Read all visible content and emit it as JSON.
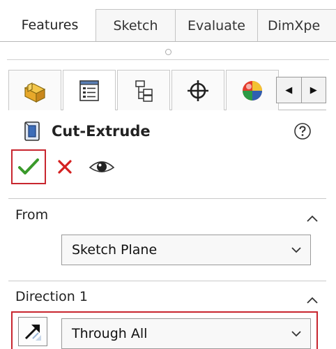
{
  "command_tabs": [
    {
      "label": "Features",
      "active": true
    },
    {
      "label": "Sketch",
      "active": false
    },
    {
      "label": "Evaluate",
      "active": false
    },
    {
      "label": "DimXpe",
      "active": false
    }
  ],
  "manager_tabs": [
    {
      "icon": "featuremanager-design-tree-icon",
      "active": false
    },
    {
      "icon": "propertymanager-icon",
      "active": true
    },
    {
      "icon": "configurationmanager-icon",
      "active": false
    },
    {
      "icon": "dimxpertmanager-icon",
      "active": false
    },
    {
      "icon": "display-manager-icon",
      "active": false
    }
  ],
  "property_manager": {
    "title": "Cut-Extrude",
    "title_icon": "cut-extrude-icon",
    "help_icon": "help-icon",
    "ok_icon": "check-icon",
    "cancel_icon": "x-icon",
    "preview_icon": "eye-icon"
  },
  "groups": {
    "from": {
      "title": "From",
      "selected": "Sketch Plane"
    },
    "direction1": {
      "title": "Direction 1",
      "selected": "Through All"
    }
  },
  "colors": {
    "accent_red": "#c8262f",
    "ok_green": "#3a9a2b",
    "cancel_red": "#d42020"
  }
}
